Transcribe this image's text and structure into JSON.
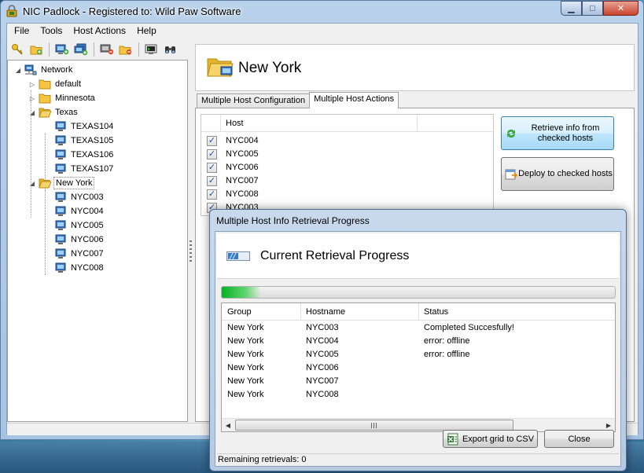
{
  "window": {
    "title": "NIC Padlock - Registered to: Wild Paw Software",
    "minimize": "▁",
    "maximize": "□",
    "close": "✕"
  },
  "menu": [
    "File",
    "Tools",
    "Host Actions",
    "Help"
  ],
  "toolbar": {
    "icons": [
      "key-icon",
      "add-folder-icon",
      "add-host-icon",
      "add-multiple-hosts-icon",
      "remove-host-icon",
      "remove-folder-icon",
      "console-icon",
      "find-icon"
    ]
  },
  "tree": {
    "root": "Network",
    "nodes": [
      {
        "label": "default",
        "type": "folder",
        "expanded": false
      },
      {
        "label": "Minnesota",
        "type": "folder",
        "expanded": false
      },
      {
        "label": "Texas",
        "type": "folder",
        "expanded": true,
        "children": [
          "TEXAS104",
          "TEXAS105",
          "TEXAS106",
          "TEXAS107"
        ]
      },
      {
        "label": "New York",
        "type": "folder",
        "expanded": true,
        "selected": true,
        "children": [
          "NYC003",
          "NYC004",
          "NYC005",
          "NYC006",
          "NYC007",
          "NYC008"
        ]
      }
    ]
  },
  "panel": {
    "title": "New York",
    "tabs": [
      "Multiple Host Configuration",
      "Multiple Host Actions"
    ],
    "active_tab": 1,
    "host_grid": {
      "header": "Host",
      "rows": [
        {
          "checked": true,
          "host": "NYC004"
        },
        {
          "checked": true,
          "host": "NYC005"
        },
        {
          "checked": true,
          "host": "NYC006"
        },
        {
          "checked": true,
          "host": "NYC007"
        },
        {
          "checked": true,
          "host": "NYC008"
        },
        {
          "checked": true,
          "host": "NYC003"
        }
      ]
    },
    "retrieve_button": "Retrieve info from checked hosts",
    "deploy_button": "Deploy to checked hosts"
  },
  "dialog": {
    "title": "Multiple Host Info Retrieval Progress",
    "heading": "Current Retrieval Progress",
    "progress_fraction": 0.1,
    "columns": [
      "Group",
      "Hostname",
      "Status"
    ],
    "rows": [
      {
        "group": "New York",
        "hostname": "NYC003",
        "status": "Completed Succesfully!"
      },
      {
        "group": "New York",
        "hostname": "NYC004",
        "status": "error: offline"
      },
      {
        "group": "New York",
        "hostname": "NYC005",
        "status": "error: offline"
      },
      {
        "group": "New York",
        "hostname": "NYC006",
        "status": ""
      },
      {
        "group": "New York",
        "hostname": "NYC007",
        "status": ""
      },
      {
        "group": "New York",
        "hostname": "NYC008",
        "status": ""
      }
    ],
    "export_button": "Export grid to CSV",
    "close_button": "Close",
    "status_text": "Remaining retrievals: 0"
  },
  "colors": {
    "accent": "#3c7fb1",
    "progress": "#06b025",
    "folder": "#f5c542"
  }
}
